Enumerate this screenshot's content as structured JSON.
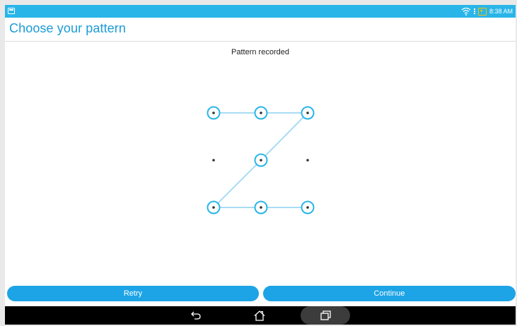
{
  "status_bar": {
    "time": "8:38 AM",
    "icons": [
      "notification-icon",
      "wifi-icon",
      "battery-charging-icon"
    ]
  },
  "header": {
    "title": "Choose your pattern"
  },
  "pattern": {
    "status_text": "Pattern recorded",
    "grid": [
      [
        1,
        1,
        1
      ],
      [
        0,
        1,
        0
      ],
      [
        1,
        1,
        1
      ]
    ],
    "sequence": [
      1,
      2,
      3,
      5,
      7,
      8,
      9
    ],
    "accent_color": "#29b5e8"
  },
  "buttons": {
    "retry_label": "Retry",
    "continue_label": "Continue"
  },
  "navigation": {
    "icons": [
      "back-icon",
      "home-icon",
      "recent-apps-icon"
    ]
  },
  "colors": {
    "accent": "#29b5e8",
    "button": "#1ca4e6",
    "title": "#1b9bd6",
    "nav_bar": "#000000"
  }
}
